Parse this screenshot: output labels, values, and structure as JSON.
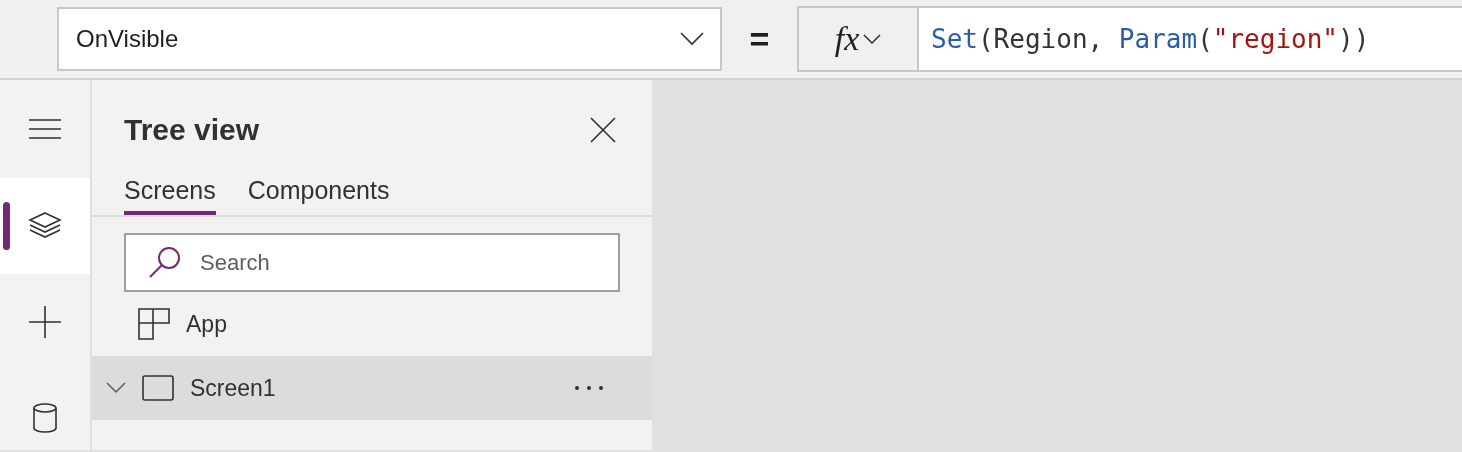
{
  "property_selector": {
    "value": "OnVisible"
  },
  "equals_sign": "=",
  "formula_button": {
    "label": "fx"
  },
  "formula": [
    {
      "kind": "function",
      "text": "Set"
    },
    {
      "kind": "plain",
      "text": "(Region, "
    },
    {
      "kind": "function",
      "text": "Param"
    },
    {
      "kind": "plain",
      "text": "("
    },
    {
      "kind": "string",
      "text": "\"region\""
    },
    {
      "kind": "plain",
      "text": "))"
    }
  ],
  "rail": [
    {
      "kind": "menu",
      "selected": false
    },
    {
      "kind": "layers",
      "selected": true
    },
    {
      "kind": "add",
      "selected": false
    },
    {
      "kind": "data",
      "selected": false
    }
  ],
  "panel": {
    "title": "Tree view",
    "tabs": [
      {
        "label": "Screens",
        "selected": true
      },
      {
        "label": "Components",
        "selected": false
      }
    ],
    "search": {
      "placeholder": "Search"
    },
    "items": [
      {
        "kind": "app",
        "label": "App",
        "selected": false
      },
      {
        "kind": "screen",
        "label": "Screen1",
        "selected": true,
        "expanded": false
      }
    ]
  }
}
